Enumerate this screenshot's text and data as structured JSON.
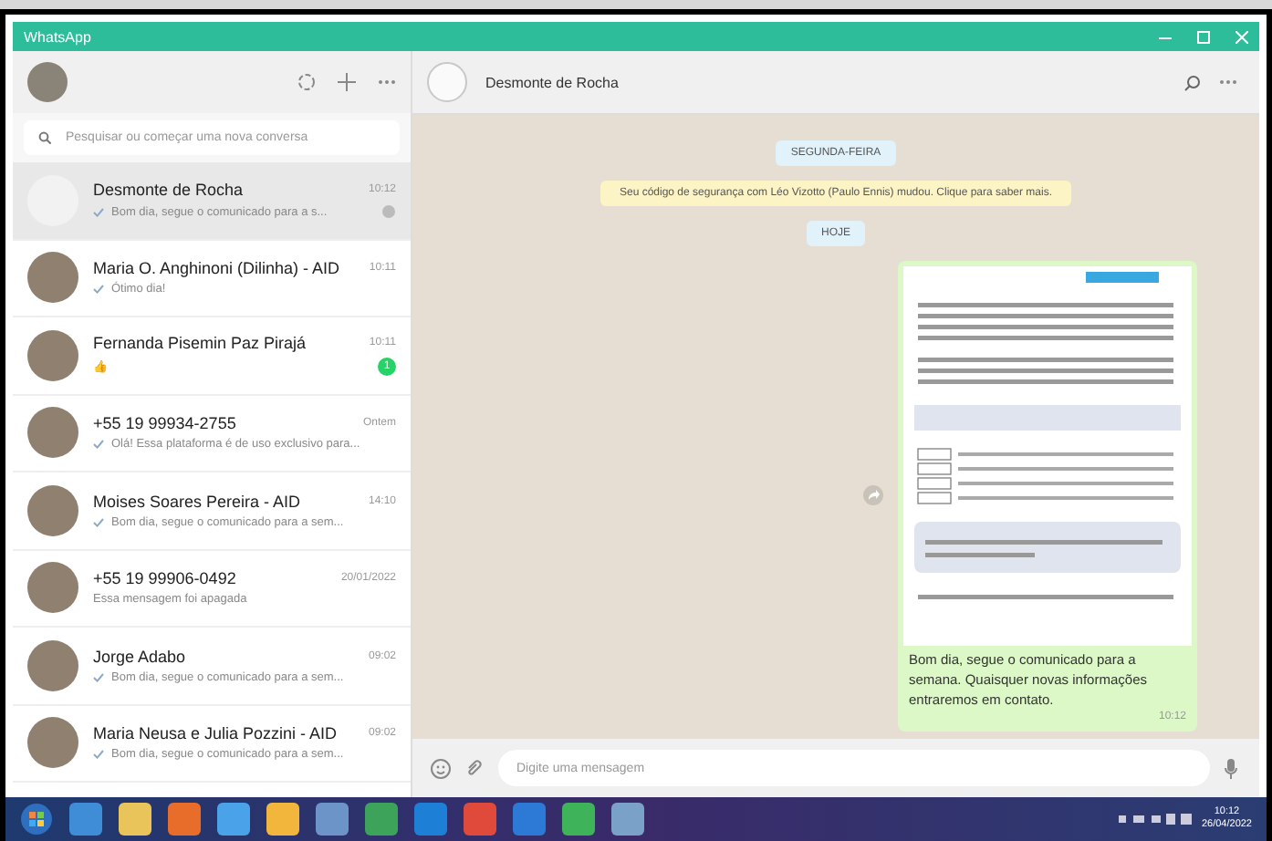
{
  "window": {
    "title": "WhatsApp"
  },
  "sidebar": {
    "search": {
      "placeholder": "Pesquisar ou começar uma nova conversa"
    },
    "chats": [
      {
        "name": "Desmonte de Rocha",
        "time": "10:12",
        "preview": "Bom dia, segue o comunicado para a s...",
        "sent": true,
        "selected": true,
        "muted": true
      },
      {
        "name": "Maria O. Anghinoni (Dilinha) - AID",
        "time": "10:11",
        "preview": "Ótimo dia!",
        "sent": true,
        "selected": false,
        "muted": false
      },
      {
        "name": "Fernanda Pisemin Paz Pirajá",
        "time": "10:11",
        "preview": "👍",
        "sent": false,
        "selected": false,
        "muted": false,
        "unread": "1"
      },
      {
        "name": "+55 19 99934-2755",
        "time": "Ontem",
        "preview": "Olá! Essa plataforma é de uso exclusivo para...",
        "sent": true,
        "selected": false,
        "muted": false
      },
      {
        "name": "Moises Soares Pereira - AID",
        "time": "14:10",
        "preview": "Bom dia, segue o comunicado para a sem...",
        "sent": true,
        "selected": false,
        "muted": false
      },
      {
        "name": "+55 19 99906-0492",
        "time": "20/01/2022",
        "preview": "Essa mensagem foi apagada",
        "sent": false,
        "selected": false,
        "muted": false
      },
      {
        "name": "Jorge Adabo",
        "time": "09:02",
        "preview": "Bom dia, segue o comunicado para a sem...",
        "sent": true,
        "selected": false,
        "muted": false
      },
      {
        "name": "Maria Neusa e Julia Pozzini - AID",
        "time": "09:02",
        "preview": "Bom dia, segue o comunicado para a sem...",
        "sent": true,
        "selected": false,
        "muted": false
      }
    ]
  },
  "chat": {
    "title": "Desmonte de Rocha",
    "messages": [
      {
        "kind": "date",
        "text": "SEGUNDA-FEIRA"
      },
      {
        "kind": "system",
        "text": "Seu código de segurança com Léo Vizotto (Paulo Ennis) mudou. Clique para saber mais."
      },
      {
        "kind": "date",
        "text": "HOJE"
      },
      {
        "kind": "image",
        "caption": "Bom dia, segue o comunicado para a semana. Quaisquer novas informações entraremos em contato.",
        "time": "10:12"
      }
    ],
    "composer": {
      "placeholder": "Digite uma mensagem"
    }
  },
  "taskbar": {
    "time": "10:12",
    "date": "26/04/2022"
  }
}
